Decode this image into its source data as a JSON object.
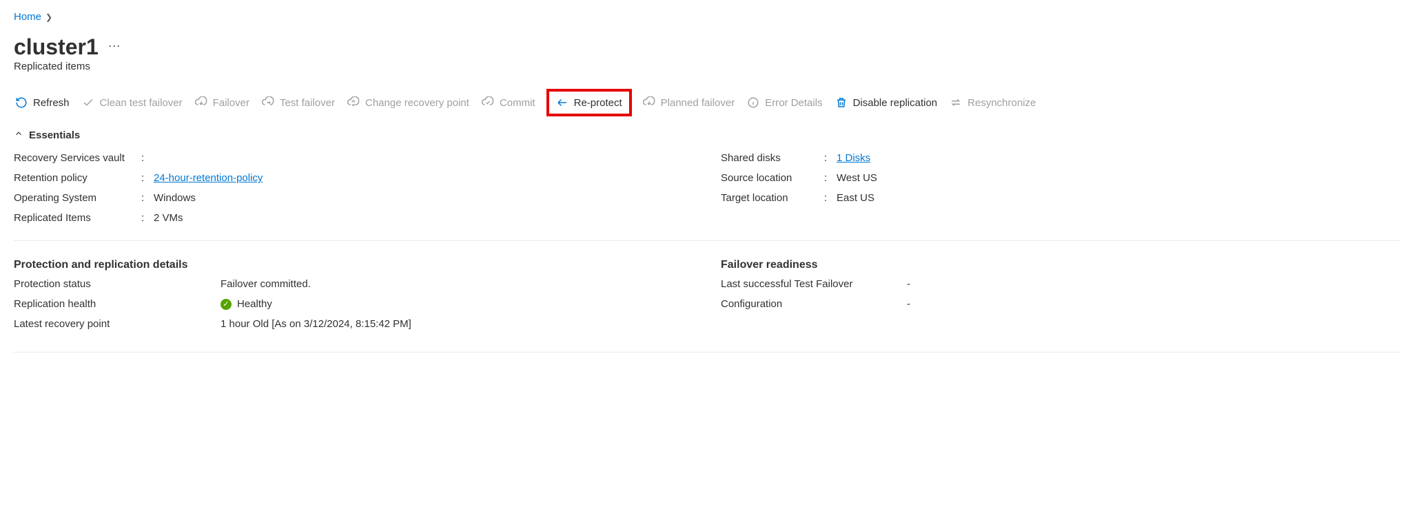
{
  "breadcrumb": {
    "home": "Home"
  },
  "title": "cluster1",
  "subtitle": "Replicated items",
  "toolbar": {
    "refresh": "Refresh",
    "clean": "Clean test failover",
    "failover": "Failover",
    "test_failover": "Test failover",
    "change_rp": "Change recovery point",
    "commit": "Commit",
    "reprotect": "Re-protect",
    "planned_failover": "Planned failover",
    "error_details": "Error Details",
    "disable_replication": "Disable replication",
    "resynchronize": "Resynchronize"
  },
  "essentials": {
    "header": "Essentials",
    "left": {
      "rsv_label": "Recovery Services vault",
      "rsv_value": "",
      "retention_label": "Retention policy",
      "retention_value": "24-hour-retention-policy",
      "os_label": "Operating System",
      "os_value": "Windows",
      "replicated_label": "Replicated Items",
      "replicated_value": "2 VMs"
    },
    "right": {
      "shared_label": "Shared disks",
      "shared_value": "1 Disks",
      "source_label": "Source location",
      "source_value": "West US",
      "target_label": "Target location",
      "target_value": "East US"
    }
  },
  "protection": {
    "heading": "Protection and replication details",
    "status_label": "Protection status",
    "status_value": "Failover committed.",
    "health_label": "Replication health",
    "health_value": "Healthy",
    "recovery_label": "Latest recovery point",
    "recovery_value": "1 hour Old [As on 3/12/2024, 8:15:42 PM]"
  },
  "readiness": {
    "heading": "Failover readiness",
    "last_label": "Last successful Test Failover",
    "last_value": "-",
    "config_label": "Configuration",
    "config_value": "-"
  }
}
